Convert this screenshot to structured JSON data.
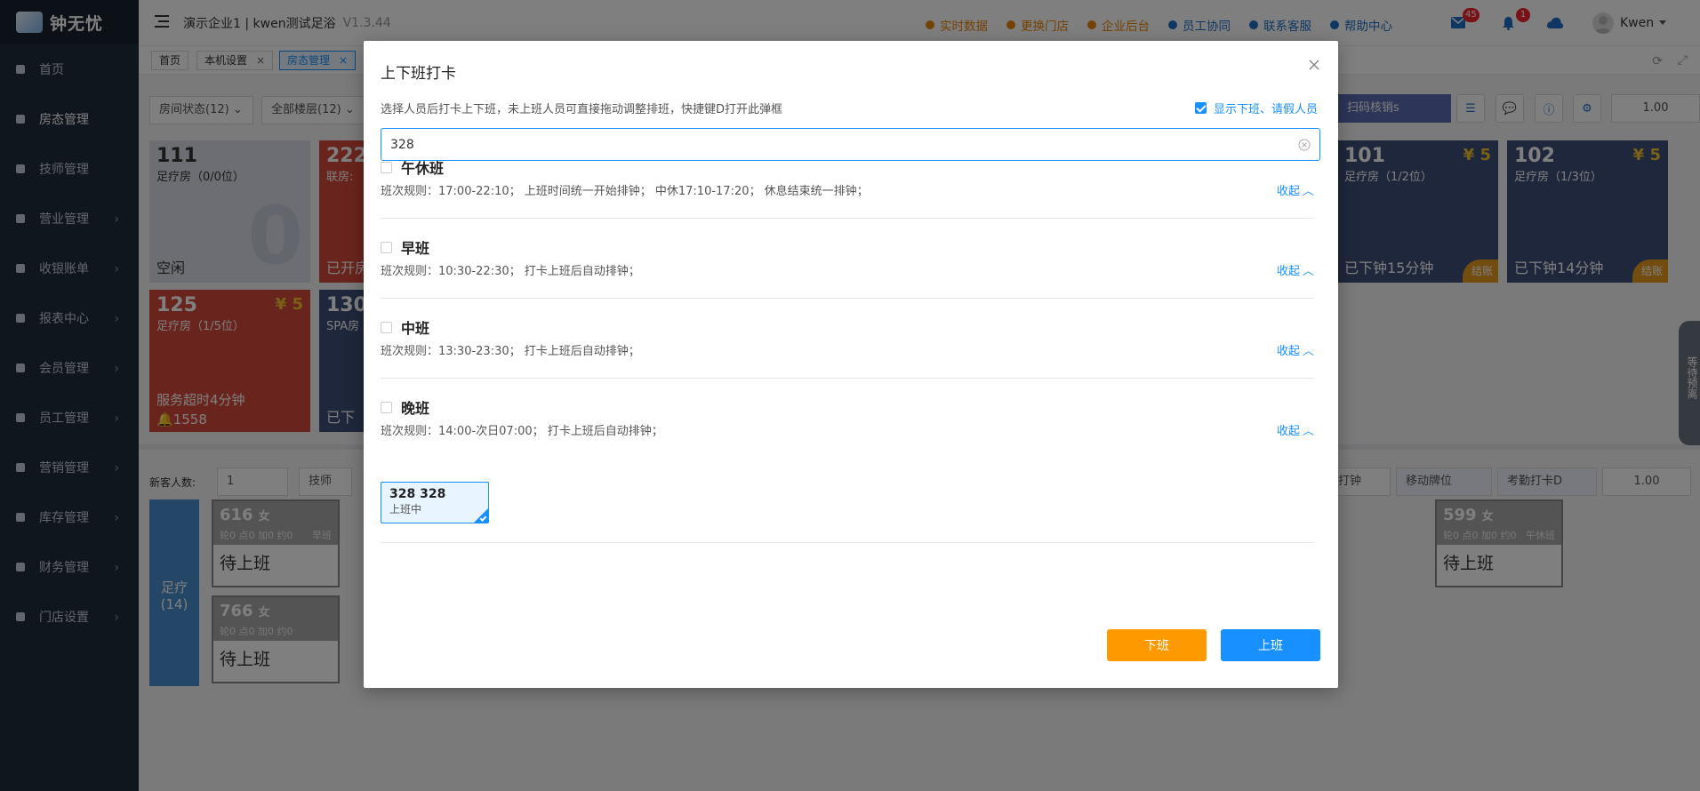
{
  "app": {
    "logo_text": "钟无忧",
    "title": "演示企业1 | kwen测试足浴",
    "version": "V1.3.44",
    "user": "Kwen"
  },
  "header_links": [
    {
      "label": "实时数据",
      "icon": "chart-line-icon"
    },
    {
      "label": "更换门店",
      "icon": "search-icon"
    },
    {
      "label": "企业后台",
      "icon": "cloud-icon"
    },
    {
      "label": "员工协同",
      "icon": "users-icon"
    },
    {
      "label": "联系客服",
      "icon": "phone-icon"
    },
    {
      "label": "帮助中心",
      "icon": "help-icon"
    }
  ],
  "badges": {
    "mail": "45",
    "bell": "1"
  },
  "sidebar": {
    "items": [
      {
        "label": "首页",
        "icon": "dashboard-icon"
      },
      {
        "label": "房态管理",
        "icon": "home-icon"
      },
      {
        "label": "技师管理",
        "icon": "user-icon"
      },
      {
        "label": "营业管理",
        "icon": "target-icon"
      },
      {
        "label": "收银账单",
        "icon": "money-bag-icon"
      },
      {
        "label": "报表中心",
        "icon": "bar-chart-icon"
      },
      {
        "label": "会员管理",
        "icon": "diamond-icon"
      },
      {
        "label": "员工管理",
        "icon": "user-icon"
      },
      {
        "label": "营销管理",
        "icon": "briefcase-icon"
      },
      {
        "label": "库存管理",
        "icon": "box-icon"
      },
      {
        "label": "财务管理",
        "icon": "wallet-icon"
      },
      {
        "label": "门店设置",
        "icon": "grid-icon"
      }
    ]
  },
  "tabs": [
    {
      "label": "首页"
    },
    {
      "label": "本机设置"
    },
    {
      "label": "房态管理"
    }
  ],
  "background": {
    "filters": [
      "房间状态(12)",
      "全部楼层(12)"
    ],
    "toolbar_scan": "扫码核销s",
    "zoom": "1.00",
    "zoom2": "1.00",
    "rooms": [
      {
        "num": "111",
        "type": "足疗房（0/0位）",
        "status": "空闲",
        "big": "0"
      },
      {
        "num": "222",
        "type": "联房:",
        "status": "已开房"
      },
      {
        "num": "101",
        "type": "足疗房（1/2位）",
        "status": "已下钟15分钟",
        "price": "¥ 5",
        "tag": "结账"
      },
      {
        "num": "102",
        "type": "足疗房（1/3位）",
        "status": "已下钟14分钟",
        "price": "¥ 5",
        "tag": "结账"
      },
      {
        "num": "125",
        "type": "足疗房（1/5位）",
        "status": "服务超时4分钟",
        "price": "¥ 5",
        "extra": "1558"
      },
      {
        "num": "130",
        "type": "SPA房",
        "status": "已下"
      }
    ],
    "new_guests_label": "新客人数:",
    "new_guests_value": "1",
    "tech_status": "技师状态(",
    "mobile_btn": "移动牌位",
    "attend_btn": "考勤打卡D",
    "clock_sel": "打钟",
    "group_label": "足疗\n(14)",
    "techs": [
      {
        "num": "616",
        "sex": "女",
        "meta": "轮0 点0 加0 约0",
        "shift": "早班",
        "status": "待上班"
      },
      {
        "num": "766",
        "sex": "女",
        "meta": "轮0 点0 加0 约0",
        "shift": "",
        "status": "待上班"
      },
      {
        "num": "599",
        "sex": "女",
        "meta": "轮0 点0 加0 约0",
        "shift": "午休班",
        "status": "待上班"
      }
    ],
    "side_tab": "等待预离"
  },
  "modal": {
    "title": "上下班打卡",
    "hint": "选择人员后打卡上下班，未上班人员可直接拖动调整排班，快捷键D打开此弹框",
    "show_off_label": "显示下班、请假人员",
    "search_value": "328",
    "fold_label": "收起",
    "shifts": [
      {
        "name": "午休班",
        "rule": "班次规则：17:00-22:10；  上班时间统一开始排钟；  中休17:10-17:20；  休息结束统一排钟；"
      },
      {
        "name": "早班",
        "rule": "班次规则：10:30-22:30；  打卡上班后自动排钟；"
      },
      {
        "name": "中班",
        "rule": "班次规则：13:30-23:30；  打卡上班后自动排钟；"
      },
      {
        "name": "晚班",
        "rule": "班次规则：14:00-次日07:00；  打卡上班后自动排钟；"
      }
    ],
    "staff": {
      "name": "328 328",
      "status": "上班中"
    },
    "btn_off": "下班",
    "btn_on": "上班"
  }
}
